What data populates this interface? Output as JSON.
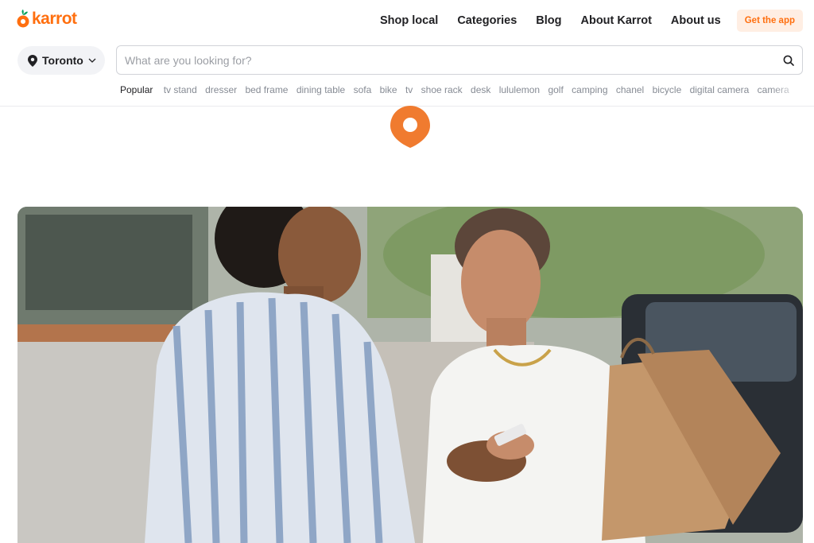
{
  "brand": {
    "name": "karrot",
    "color": "#ff6f0f"
  },
  "nav": {
    "links": [
      "Shop local",
      "Categories",
      "Blog",
      "About Karrot",
      "About us"
    ],
    "cta": "Get the app"
  },
  "location": {
    "label": "Toronto",
    "icon": "location-pin-icon"
  },
  "search": {
    "placeholder": "What are you looking for?",
    "value": "",
    "icon": "search-icon"
  },
  "popular": {
    "label": "Popular",
    "items": [
      "tv stand",
      "dresser",
      "bed frame",
      "dining table",
      "sofa",
      "bike",
      "tv",
      "shoe rack",
      "desk",
      "lululemon",
      "golf",
      "camping",
      "chanel",
      "bicycle",
      "digital camera",
      "camera"
    ]
  },
  "hero": {
    "image": "two-women-shopping-photo"
  }
}
